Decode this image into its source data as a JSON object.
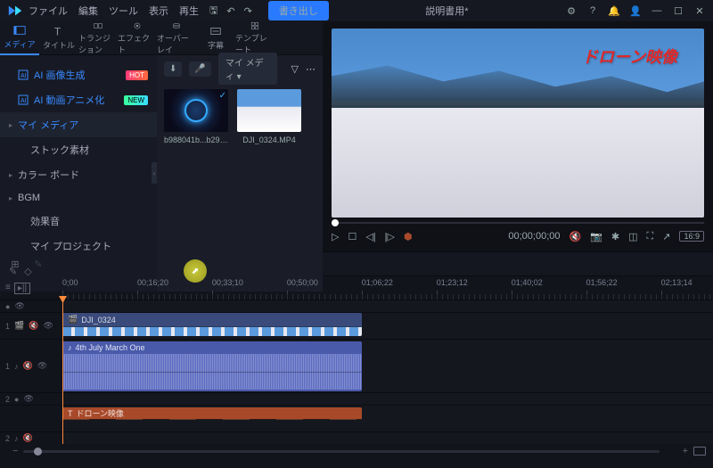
{
  "menu": [
    "ファイル",
    "編集",
    "ツール",
    "表示",
    "再生"
  ],
  "export_label": "書き出し",
  "project_title": "説明書用*",
  "tabs": [
    {
      "label": "メディア"
    },
    {
      "label": "タイトル"
    },
    {
      "label": "トランジション"
    },
    {
      "label": "エフェクト"
    },
    {
      "label": "オーバーレイ"
    },
    {
      "label": "字幕"
    },
    {
      "label": "テンプレート"
    }
  ],
  "sidebar": {
    "ai_image": "AI 画像生成",
    "ai_anim": "AI 動画アニメ化",
    "badge_hot": "HOT",
    "badge_new": "NEW",
    "my_media": "マイ メディア",
    "stock": "ストック素材",
    "color_board": "カラー ボード",
    "bgm": "BGM",
    "sfx": "効果音",
    "my_project": "マイ プロジェクト"
  },
  "media_dropdown": "マイ メディ",
  "media_items": [
    {
      "name": "b988041b...b29b..."
    },
    {
      "name": "DJI_0324.MP4"
    }
  ],
  "preview": {
    "overlay_title": "ドローン映像",
    "timecode": "00;00;00;00",
    "aspect": "16:9"
  },
  "ruler": [
    "0;00",
    "00;16;20",
    "00;33;10",
    "00;50;00",
    "01;06;22",
    "01;23;12",
    "01;40;02",
    "01;56;22",
    "02;13;14"
  ],
  "tracks": {
    "video_clip": "DJI_0324",
    "audio_clip": "4th July March One",
    "text_clip": "ドローン映像"
  }
}
